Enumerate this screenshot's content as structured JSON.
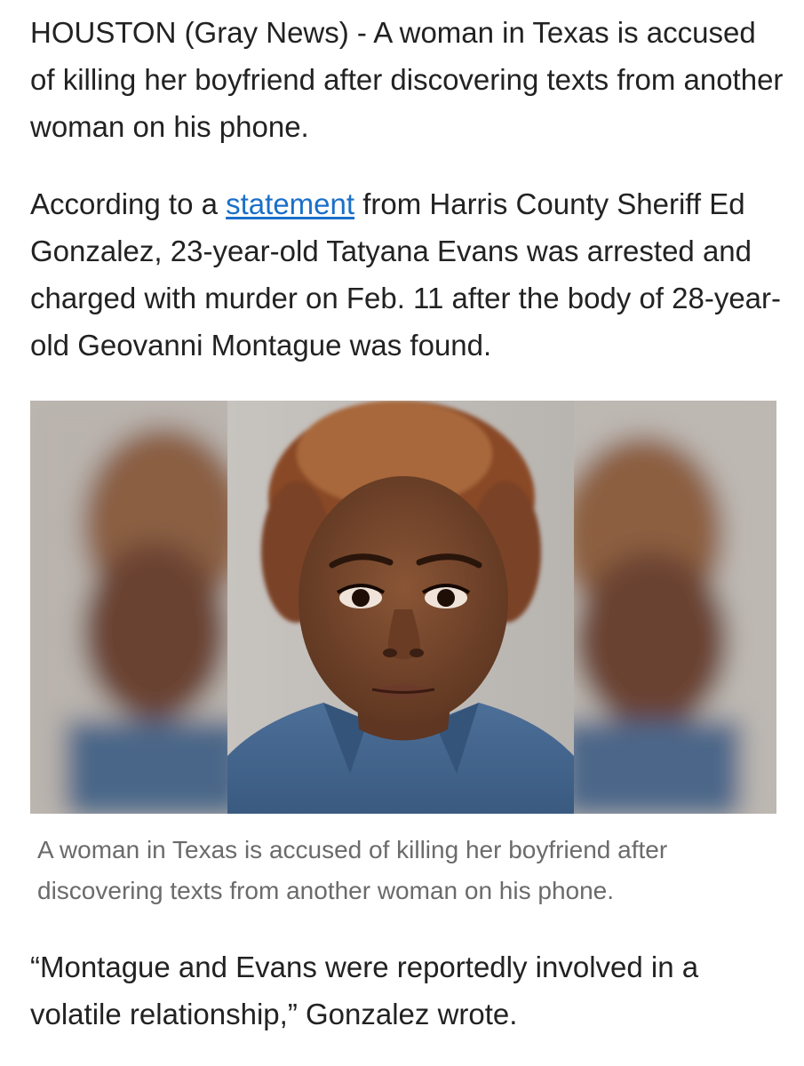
{
  "article": {
    "paragraph_1": "HOUSTON (Gray News) - A woman in Texas is accused of killing her boyfriend after discovering texts from another woman on his phone.",
    "paragraph_2": {
      "before_link": "According to a ",
      "link_text": "statement",
      "after_link": " from Harris County Sheriff Ed Gonzalez, 23-year-old Tatyana Evans was arrested and charged with murder on Feb. 11 after the body of 28-year-old Geovanni Montague was found."
    },
    "photo": {
      "caption": "A woman in Texas is accused of killing her boyfriend after discovering texts from another woman on his phone."
    },
    "paragraph_3": "“Montague and Evans were reportedly involved in a volatile relationship,” Gonzalez wrote."
  },
  "colors": {
    "body_text": "#222222",
    "link": "#1a6fc9",
    "caption_text": "#6b6b6b",
    "photo_background": "#bdb7b0"
  }
}
